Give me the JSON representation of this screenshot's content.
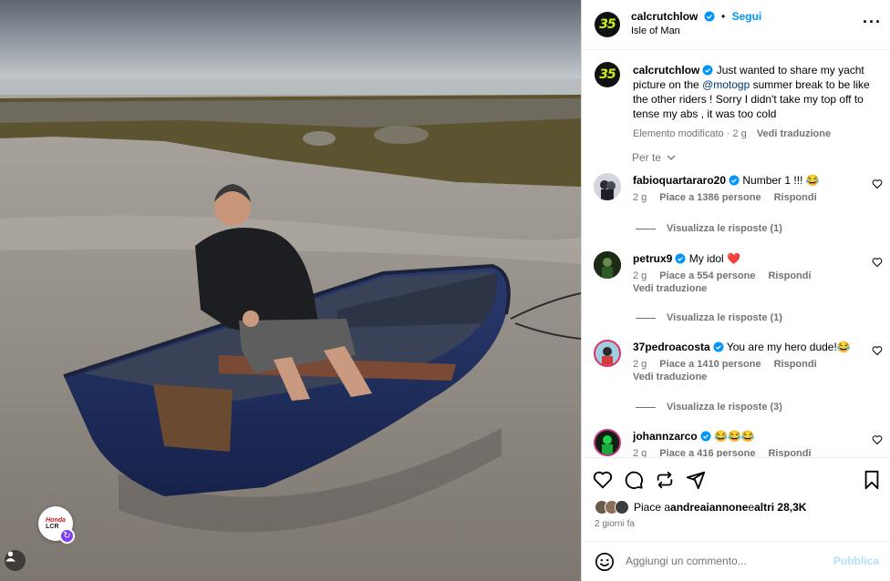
{
  "colors": {
    "accent": "#0095f6",
    "verified": "#0095f6",
    "muted": "#737373",
    "mention": "#00376b"
  },
  "photo": {
    "tag_badge_brand": "Honda",
    "tag_badge_team": "LCR"
  },
  "header": {
    "username": "calcrutchlow",
    "avatar_text": "35",
    "dot": "•",
    "follow_label": "Segui",
    "location": "Isle of Man",
    "more_icon": "more-horizontal-icon"
  },
  "caption": {
    "username": "calcrutchlow",
    "text_before": " Just wanted to share my yacht picture on the ",
    "mention": "@motogp",
    "text_after": " summer break to be like the other riders ! Sorry I didn't take my top off to tense my abs , it was too cold",
    "edited": "Elemento modificato",
    "time": "· 2 g",
    "translate": "Vedi traduzione"
  },
  "sort_label": "Per te",
  "comments": [
    {
      "username": "fabioquartararo20",
      "text": "Number 1 !!! 😂",
      "time": "2 g",
      "likes": "Piace a 1386 persone",
      "reply": "Rispondi",
      "translate": "",
      "replies": "Visualizza le risposte (1)"
    },
    {
      "username": "petrux9",
      "text": "My idol ❤️",
      "time": "2 g",
      "likes": "Piace a 554 persone",
      "reply": "Rispondi",
      "translate": "Vedi traduzione",
      "replies": "Visualizza le risposte (1)"
    },
    {
      "username": "37pedroacosta",
      "text": "You are my hero dude!😂",
      "time": "2 g",
      "likes": "Piace a 1410 persone",
      "reply": "Rispondi",
      "translate": "Vedi traduzione",
      "replies": "Visualizza le risposte (3)"
    },
    {
      "username": "johannzarco",
      "text": "😂😂😂",
      "time": "2 g",
      "likes": "Piace a 416 persone",
      "reply": "Rispondi",
      "translate": "",
      "replies": ""
    }
  ],
  "actions": {
    "like_icon": "heart-icon",
    "comment_icon": "comment-icon",
    "repost_icon": "repost-icon",
    "share_icon": "send-icon",
    "save_icon": "bookmark-icon",
    "likes_prefix": "Piace a ",
    "likes_user": "andreaiannone",
    "likes_mid": " e ",
    "likes_others": "altri 28,3K",
    "time_ago": "2 giorni fa"
  },
  "add_comment": {
    "placeholder": "Aggiungi un commento...",
    "publish": "Pubblica"
  }
}
